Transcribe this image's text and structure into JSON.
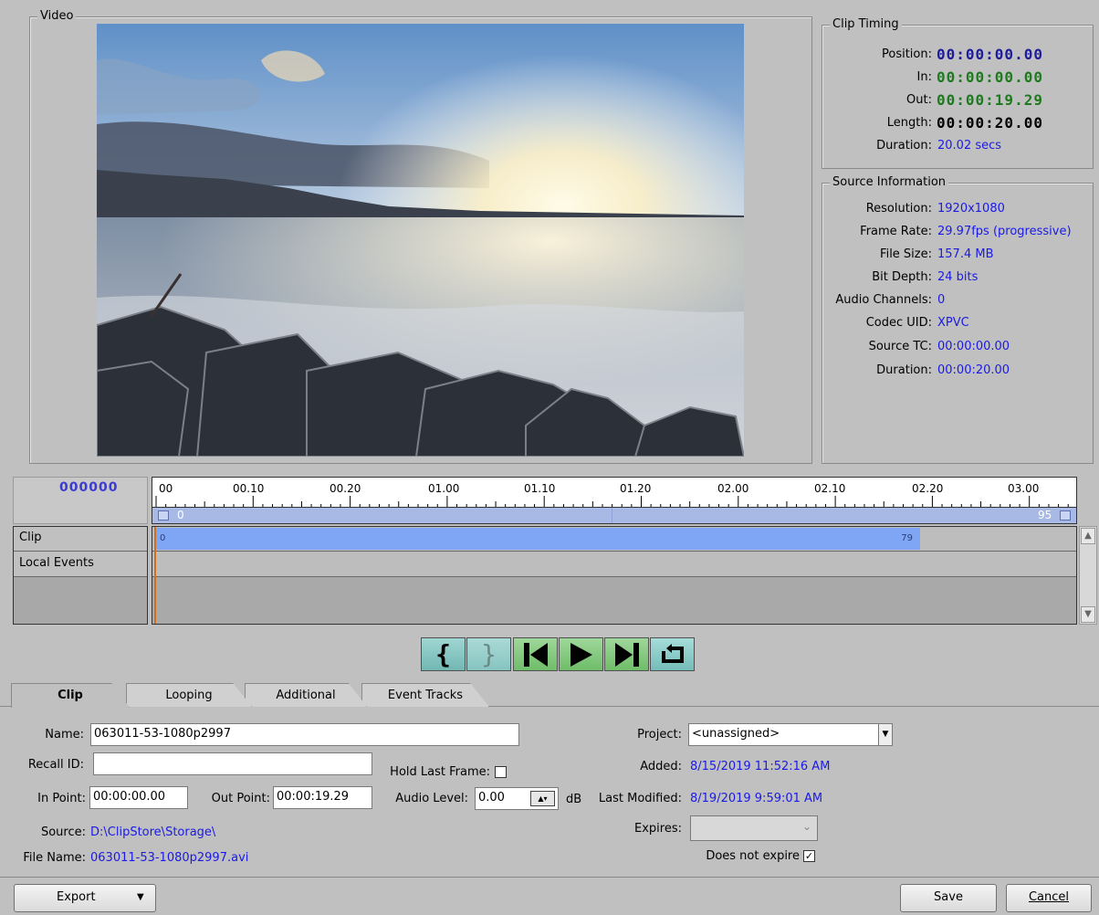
{
  "video": {
    "title": "Video"
  },
  "clip_timing": {
    "title": "Clip Timing",
    "position_label": "Position:",
    "position": "00:00:00.00",
    "in_label": "In:",
    "in": "00:00:00.00",
    "out_label": "Out:",
    "out": "00:00:19.29",
    "length_label": "Length:",
    "length": "00:00:20.00",
    "duration_label": "Duration:",
    "duration": "20.02 secs",
    "colors": {
      "position": "#1b1b9c",
      "in_out": "#1e7a1e",
      "length": "#000000"
    }
  },
  "source_info": {
    "title": "Source Information",
    "rows": [
      {
        "label": "Resolution:",
        "value": "1920x1080"
      },
      {
        "label": "Frame Rate:",
        "value": "29.97fps (progressive)"
      },
      {
        "label": "File Size:",
        "value": "157.4 MB"
      },
      {
        "label": "Bit Depth:",
        "value": "24 bits"
      },
      {
        "label": "Audio Channels:",
        "value": "0"
      },
      {
        "label": "Codec UID:",
        "value": "XPVC"
      },
      {
        "label": "Source TC:",
        "value": "00:00:00.00"
      },
      {
        "label": "Duration:",
        "value": "00:00:20.00"
      }
    ]
  },
  "timeline": {
    "frame_counter": "000000",
    "ruler_labels": [
      "00",
      "00.10",
      "00.20",
      "01.00",
      "01.10",
      "01.20",
      "02.00",
      "02.10",
      "02.20",
      "03.00"
    ],
    "range_start": "0",
    "range_end": "95",
    "tracks": [
      {
        "label": "Clip"
      },
      {
        "label": "Local Events"
      }
    ],
    "clip_start": "0",
    "clip_end": "79"
  },
  "transport": {
    "mark_in_icon": "mark-in-brace-icon",
    "mark_out_icon": "mark-out-brace-icon",
    "go_start_icon": "skip-to-start-icon",
    "play_icon": "play-icon",
    "go_end_icon": "skip-to-end-icon",
    "loop_icon": "loop-icon"
  },
  "tabs": [
    {
      "label": "Clip",
      "active": true
    },
    {
      "label": "Looping"
    },
    {
      "label": "Additional"
    },
    {
      "label": "Event Tracks"
    }
  ],
  "form": {
    "name_label": "Name:",
    "name": "063011-53-1080p2997",
    "recall_label": "Recall ID:",
    "recall": "",
    "hold_last_label": "Hold Last Frame:",
    "in_point_label": "In Point:",
    "in_point": "00:00:00.00",
    "out_point_label": "Out Point:",
    "out_point": "00:00:19.29",
    "audio_level_label": "Audio Level:",
    "audio_level": "0.00",
    "audio_unit": "dB",
    "source_label": "Source:",
    "source": "D:\\ClipStore\\Storage\\",
    "file_name_label": "File Name:",
    "file_name": "063011-53-1080p2997.avi",
    "project_label": "Project:",
    "project": "<unassigned>",
    "added_label": "Added:",
    "added": "8/15/2019 11:52:16 AM",
    "modified_label": "Last Modified:",
    "modified": "8/19/2019 9:59:01 AM",
    "expires_label": "Expires:",
    "expires": "",
    "no_expire_label": "Does not expire"
  },
  "footer": {
    "export": "Export",
    "save": "Save",
    "cancel": "Cancel"
  }
}
